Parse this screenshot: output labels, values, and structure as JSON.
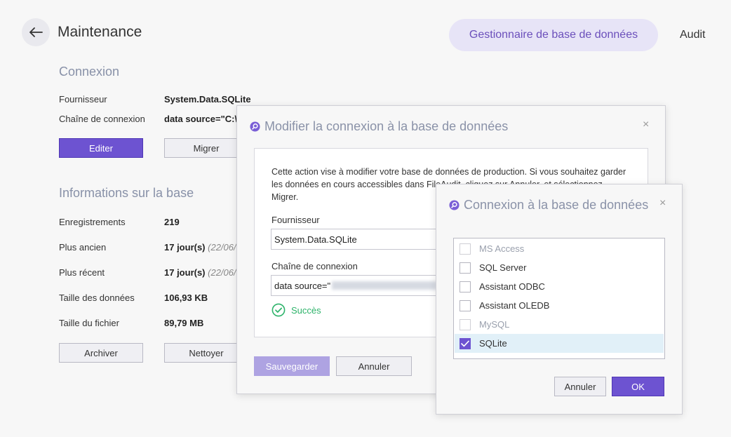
{
  "header": {
    "title": "Maintenance",
    "tabs": [
      {
        "label": "Gestionnaire de base de données",
        "active": true
      },
      {
        "label": "Audit",
        "active": false
      }
    ]
  },
  "connexion": {
    "title": "Connexion",
    "provider_label": "Fournisseur",
    "provider_value": "System.Data.SQLite",
    "conn_label": "Chaîne de connexion",
    "conn_value": "data source=\"C:\\",
    "edit_label": "Editer",
    "migrate_label": "Migrer"
  },
  "info": {
    "title": "Informations sur la base",
    "rows": [
      {
        "label": "Enregistrements",
        "value": "219",
        "extra": ""
      },
      {
        "label": "Plus ancien",
        "value": "17 jour(s)",
        "extra": "(22/06/"
      },
      {
        "label": "Plus récent",
        "value": "17 jour(s)",
        "extra": "(22/06/"
      },
      {
        "label": "Taille des données",
        "value": "106,93 KB",
        "extra": ""
      },
      {
        "label": "Taille du fichier",
        "value": "89,79 MB",
        "extra": ""
      }
    ],
    "archive_label": "Archiver",
    "clean_label": "Nettoyer"
  },
  "modify_dialog": {
    "title": "Modifier la connexion à la base de données",
    "message": "Cette action vise à modifier votre base de données de production. Si vous souhaitez garder les données en cours accessibles dans FileAudit, cliquez sur Annuler, et sélectionnez Migrer.",
    "provider_label": "Fournisseur",
    "provider_value": "System.Data.SQLite",
    "conn_label": "Chaîne de connexion",
    "conn_value": "data source=\"",
    "status_text": "Succès",
    "save_label": "Sauvegarder",
    "cancel_label": "Annuler",
    "close_glyph": "×"
  },
  "conn_dialog": {
    "title": "Connexion à la base de données",
    "items": [
      {
        "label": "MS Access",
        "checked": false,
        "disabled": true
      },
      {
        "label": "SQL Server",
        "checked": false,
        "disabled": false
      },
      {
        "label": "Assistant ODBC",
        "checked": false,
        "disabled": false
      },
      {
        "label": "Assistant OLEDB",
        "checked": false,
        "disabled": false
      },
      {
        "label": "MySQL",
        "checked": false,
        "disabled": true
      },
      {
        "label": "SQLite",
        "checked": true,
        "disabled": false
      }
    ],
    "cancel_label": "Annuler",
    "ok_label": "OK",
    "close_glyph": "×"
  },
  "colors": {
    "accent": "#6d53d1",
    "success": "#2db36a",
    "selected_row": "#e1f0f8"
  }
}
